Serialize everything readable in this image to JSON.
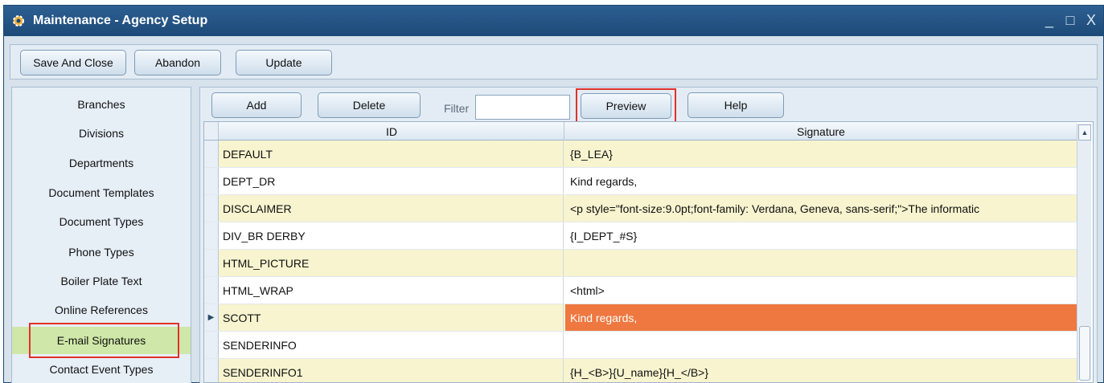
{
  "window": {
    "title": "Maintenance - Agency Setup",
    "controls": {
      "minimize": "_",
      "maximize": "□",
      "close": "X"
    }
  },
  "top_toolbar": {
    "save_and_close": "Save And Close",
    "abandon": "Abandon",
    "update": "Update"
  },
  "sidebar": {
    "items": [
      {
        "label": "Branches"
      },
      {
        "label": "Divisions"
      },
      {
        "label": "Departments"
      },
      {
        "label": "Document Templates"
      },
      {
        "label": "Document Types"
      },
      {
        "label": "Phone Types"
      },
      {
        "label": "Boiler Plate Text"
      },
      {
        "label": "Online References"
      },
      {
        "label": "E-mail Signatures",
        "selected": true
      },
      {
        "label": "Contact Event Types"
      }
    ]
  },
  "main_toolbar": {
    "add": "Add",
    "delete": "Delete",
    "filter_label": "Filter",
    "filter_value": "",
    "preview": "Preview",
    "help": "Help"
  },
  "grid": {
    "columns": [
      "ID",
      "Signature"
    ],
    "rows": [
      {
        "id": "DEFAULT",
        "signature": "{B_LEA}"
      },
      {
        "id": "DEPT_DR",
        "signature": "Kind regards,"
      },
      {
        "id": "DISCLAIMER",
        "signature": "<p style=\"font-size:9.0pt;font-family: Verdana, Geneva, sans-serif;\">The informatic"
      },
      {
        "id": "DIV_BR DERBY",
        "signature": "{I_DEPT_#S}"
      },
      {
        "id": "HTML_PICTURE",
        "signature": ""
      },
      {
        "id": "HTML_WRAP",
        "signature": "<html>"
      },
      {
        "id": "SCOTT",
        "signature": "Kind regards,",
        "selected": true
      },
      {
        "id": "SENDERINFO",
        "signature": ""
      },
      {
        "id": "SENDERINFO1",
        "signature": "{H_<B>}{U_name}{H_</B>}"
      }
    ]
  },
  "colors": {
    "titlebar": "#1d4a78",
    "selected_sidebar": "#cfe7a8",
    "selected_cell": "#ee7840",
    "odd_row": "#f7f4cf",
    "highlight_box": "#e0312c"
  },
  "icons": {
    "app": "gear-icon",
    "row_indicator": "triangle-right-icon",
    "scroll_up": "triangle-up-icon"
  }
}
